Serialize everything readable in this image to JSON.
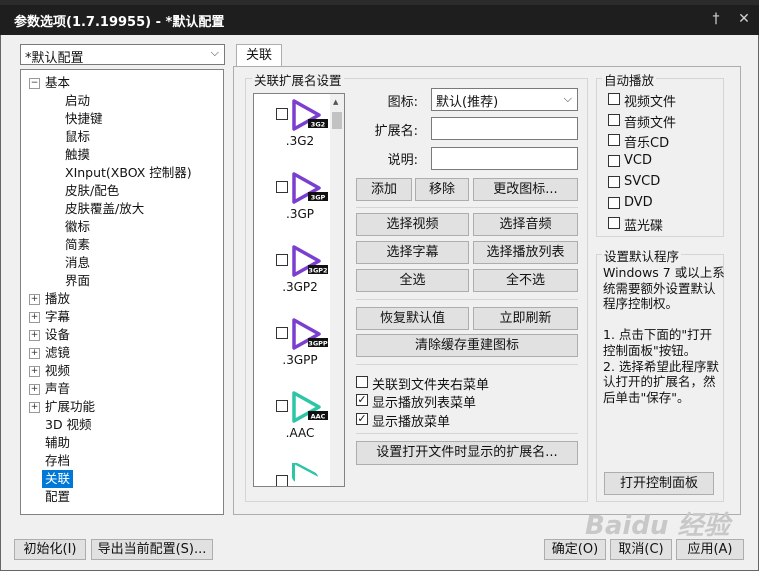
{
  "window": {
    "title": "参数选项(1.7.19955) - *默认配置",
    "pin_icon": "pin-icon",
    "close_icon": "close-icon"
  },
  "profile_select": {
    "value": "*默认配置"
  },
  "tree": {
    "basic": "基本",
    "basic_children": [
      "启动",
      "快捷键",
      "鼠标",
      "触摸",
      "XInput(XBOX 控制器)",
      "皮肤/配色",
      "皮肤覆盖/放大",
      "徽标",
      "简素",
      "消息",
      "界面"
    ],
    "items": [
      "播放",
      "字幕",
      "设备",
      "滤镜",
      "视频",
      "声音",
      "扩展功能"
    ],
    "leaves": [
      "3D 视频",
      "辅助",
      "存档"
    ],
    "selected": "关联",
    "last": "配置"
  },
  "tab_label": "关联",
  "assoc": {
    "group_title": "关联扩展名设置",
    "files": [
      {
        "ext": ".3G2",
        "badge": "3G2",
        "color": "#7b3fd0"
      },
      {
        "ext": ".3GP",
        "badge": "3GP",
        "color": "#7b3fd0"
      },
      {
        "ext": ".3GP2",
        "badge": "3GP2",
        "color": "#7b3fd0"
      },
      {
        "ext": ".3GPP",
        "badge": "3GPP",
        "color": "#7b3fd0"
      },
      {
        "ext": ".AAC",
        "badge": "AAC",
        "color": "#2cc6a6"
      }
    ],
    "icon_label": "图标:",
    "icon_value": "默认(推荐)",
    "ext_label": "扩展名:",
    "ext_value": "",
    "desc_label": "说明:",
    "desc_value": "",
    "btn_add": "添加",
    "btn_remove": "移除",
    "btn_change_icon": "更改图标...",
    "btn_select_video": "选择视频",
    "btn_select_audio": "选择音频",
    "btn_select_sub": "选择字幕",
    "btn_select_playlist": "选择播放列表",
    "btn_select_all": "全选",
    "btn_select_none": "全不选",
    "btn_restore": "恢复默认值",
    "btn_refresh": "立即刷新",
    "btn_clear_cache": "清除缓存重建图标",
    "cb_folder_menu": {
      "label": "关联到文件夹右菜单",
      "checked": false
    },
    "cb_playlist_menu": {
      "label": "显示播放列表菜单",
      "checked": true
    },
    "cb_play_menu": {
      "label": "显示播放菜单",
      "checked": true
    },
    "btn_open_ext": "设置打开文件时显示的扩展名..."
  },
  "autoplay": {
    "title": "自动播放",
    "items": [
      {
        "label": "视频文件",
        "checked": false
      },
      {
        "label": "音频文件",
        "checked": false
      },
      {
        "label": "音乐CD",
        "checked": false
      },
      {
        "label": "VCD",
        "checked": false
      },
      {
        "label": "SVCD",
        "checked": false
      },
      {
        "label": "DVD",
        "checked": false
      },
      {
        "label": "蓝光碟",
        "checked": false
      }
    ]
  },
  "default_program": {
    "title": "设置默认程序",
    "lines": [
      "Windows 7 或以上系",
      "统需要额外设置默认",
      "程序控制权。",
      "",
      "1. 点击下面的\"打开",
      "控制面板\"按钮。",
      "2. 选择希望此程序默",
      "认打开的扩展名，然",
      "后单击\"保存\"。"
    ],
    "button": "打开控制面板"
  },
  "footer": {
    "init": "初始化(I)",
    "export": "导出当前配置(S)...",
    "ok": "确定(O)",
    "cancel": "取消(C)",
    "apply": "应用(A)"
  },
  "watermark": "Baidu 经验"
}
